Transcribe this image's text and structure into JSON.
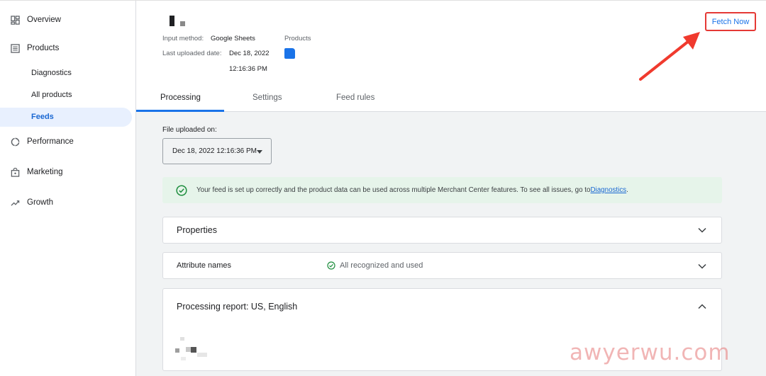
{
  "sidebar": {
    "items": [
      {
        "label": "Overview",
        "icon": "dashboard-icon"
      },
      {
        "label": "Products",
        "icon": "list-icon"
      },
      {
        "label": "Performance",
        "icon": "performance-icon"
      },
      {
        "label": "Marketing",
        "icon": "shopping-bag-icon"
      },
      {
        "label": "Growth",
        "icon": "trending-up-icon"
      }
    ],
    "sub_items": [
      {
        "label": "Diagnostics"
      },
      {
        "label": "All products"
      },
      {
        "label": "Feeds",
        "active": true
      }
    ]
  },
  "header": {
    "input_method_label": "Input method:",
    "input_method_value": "Google Sheets",
    "products_label": "Products",
    "last_uploaded_label": "Last uploaded date:",
    "last_uploaded_date": "Dec 18, 2022",
    "last_uploaded_time": "12:16:36 PM",
    "fetch_now": "Fetch Now"
  },
  "tabs": [
    {
      "label": "Processing",
      "active": true
    },
    {
      "label": "Settings"
    },
    {
      "label": "Feed rules"
    }
  ],
  "main": {
    "file_uploaded_label": "File uploaded on:",
    "file_uploaded_value": "Dec 18, 2022 12:16:36 PM",
    "banner_text": "Your feed is set up correctly and the product data can be used across multiple Merchant Center features. To see all issues, go to ",
    "banner_link": "Diagnostics",
    "banner_end": ".",
    "cards": [
      {
        "title": "Properties",
        "expanded": false
      },
      {
        "title": "Attribute names",
        "status": "All recognized and used",
        "expanded": false
      },
      {
        "title": "Processing report: US, English",
        "expanded": true
      }
    ]
  },
  "watermark": "awyerwu.com",
  "colors": {
    "accent": "#1a73e8",
    "highlight_box": "#e53935",
    "success": "#1e8e3e",
    "banner_bg": "#e6f4ea"
  }
}
